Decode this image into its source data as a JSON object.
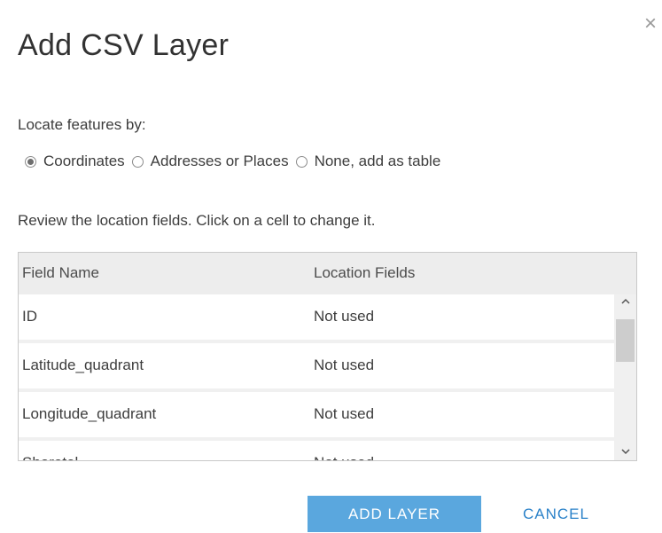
{
  "dialog": {
    "title": "Add CSV Layer",
    "close_glyph": "×"
  },
  "locate": {
    "label": "Locate features by:",
    "options": [
      {
        "label": "Coordinates",
        "checked": true
      },
      {
        "label": "Addresses or Places",
        "checked": false
      },
      {
        "label": "None, add as table",
        "checked": false
      }
    ]
  },
  "review": {
    "text": "Review the location fields. Click on a cell to change it."
  },
  "table": {
    "headers": [
      "Field Name",
      "Location Fields"
    ],
    "rows": [
      [
        "ID",
        "Not used"
      ],
      [
        "Latitude_quadrant",
        "Not used"
      ],
      [
        "Longitude_quadrant",
        "Not used"
      ],
      [
        "Shoretel",
        "Not used"
      ]
    ]
  },
  "scrollbar": {
    "up_glyph": "^",
    "down_glyph": "v"
  },
  "buttons": {
    "add": "ADD LAYER",
    "cancel": "CANCEL"
  },
  "colors": {
    "primary": "#5aa7de",
    "link": "#2b82c9"
  }
}
